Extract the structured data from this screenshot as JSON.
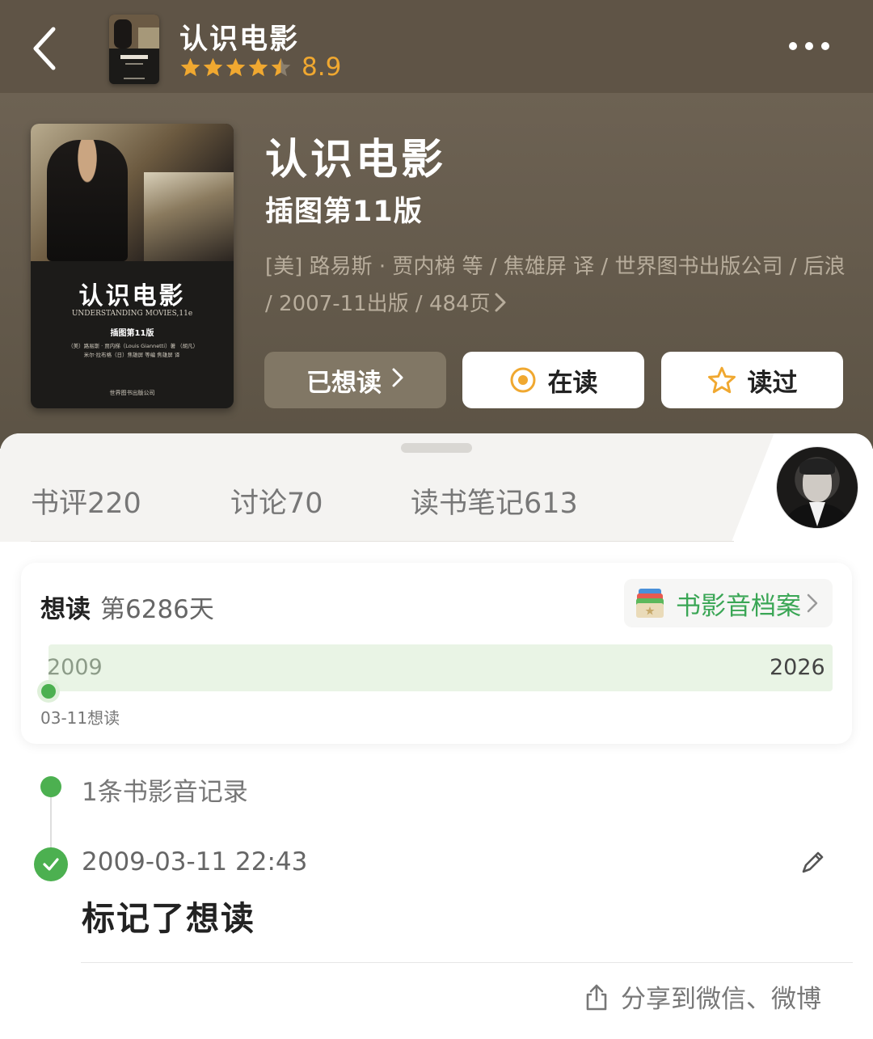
{
  "nav": {
    "title": "认识电影",
    "rating": "8.9",
    "stars_filled": 4.5,
    "star_color": "#f0a830"
  },
  "book": {
    "title": "认识电影",
    "subtitle": "插图第11版",
    "meta": "[美] 路易斯 · 贾内梯 等 / 焦雄屏 译 / 世界图书出版公司 / 后浪 / 2007-11出版 / 484页",
    "cover": {
      "title": "认识电影",
      "title_en": "UNDERSTANDING MOVIES,11e",
      "edition": "插图第11版",
      "authors": "（美）路易斯 · 贾内梯（Louis Giannetti）著 （胡凡）米尔·拉布格（日）焦雄屏 等编 焦雄屏 译",
      "publisher": "世界图书出版公司"
    }
  },
  "actions": {
    "wanted": "已想读",
    "reading": "在读",
    "read": "读过"
  },
  "tabs": [
    {
      "label": "书评220"
    },
    {
      "label": "讨论70"
    },
    {
      "label": "读书笔记613"
    }
  ],
  "card": {
    "want_label": "想读",
    "day_text": "第6286天",
    "archive_label": "书影音档案",
    "year_start": "2009",
    "year_end": "2026",
    "mark_label": "03-11想读",
    "accent": "#4cb050"
  },
  "records": {
    "count_text": "1条书影音记录",
    "time": "2009-03-11 22:43",
    "action": "标记了想读",
    "share": "分享到微信、微博"
  },
  "icons": [
    "back-icon",
    "more-icon",
    "star-icon",
    "chevron-right-icon",
    "reading-target-icon",
    "star-outline-icon",
    "archive-icon",
    "check-icon",
    "edit-pencil-icon",
    "share-icon"
  ]
}
